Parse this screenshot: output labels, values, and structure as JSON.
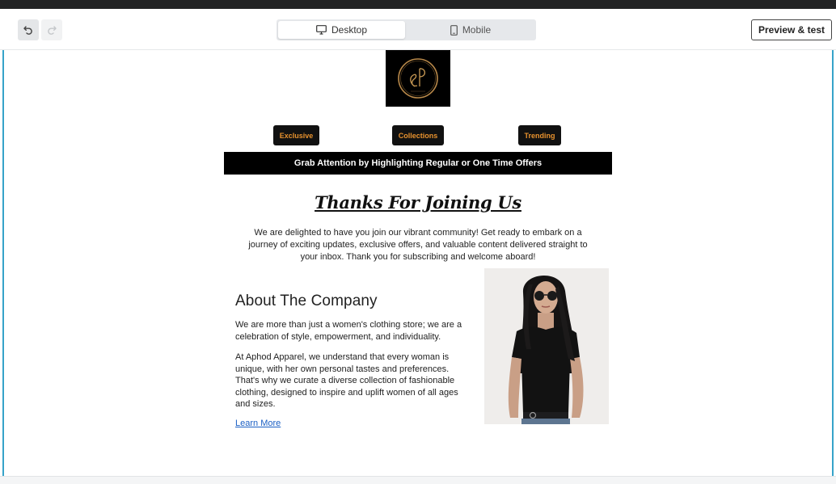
{
  "toolbar": {
    "undo_icon": "undo-icon",
    "redo_icon": "redo-icon",
    "devices": [
      {
        "label": "Desktop",
        "icon": "desktop-icon",
        "selected": true
      },
      {
        "label": "Mobile",
        "icon": "mobile-icon",
        "selected": false
      }
    ],
    "preview_label": "Preview & test"
  },
  "email": {
    "logo_icon": "ampersand-p-logo",
    "nav": [
      "Exclusive",
      "Collections",
      "Trending"
    ],
    "offer_text": "Grab Attention by Highlighting Regular or One Time Offers",
    "title": "Thanks For Joining Us",
    "intro": "We are delighted to have you join our vibrant community! Get ready to embark on a journey of exciting updates, exclusive offers, and valuable content delivered straight to your inbox. Thank you for subscribing and welcome aboard!",
    "about": {
      "heading": "About The Company",
      "paragraph1": "We are more than just a women's clothing store; we are a celebration of style, empowerment, and individuality.",
      "paragraph2": "At Aphod Apparel, we understand that every woman is unique, with her own personal tastes and preferences. That's why we curate a diverse collection of fashionable clothing, designed to inspire and uplift women of all ages and sizes.",
      "link": "Learn More"
    }
  },
  "colors": {
    "accent_orange": "#e8922e",
    "frame_blue": "#36a3c9",
    "link_blue": "#1a5fc4"
  }
}
